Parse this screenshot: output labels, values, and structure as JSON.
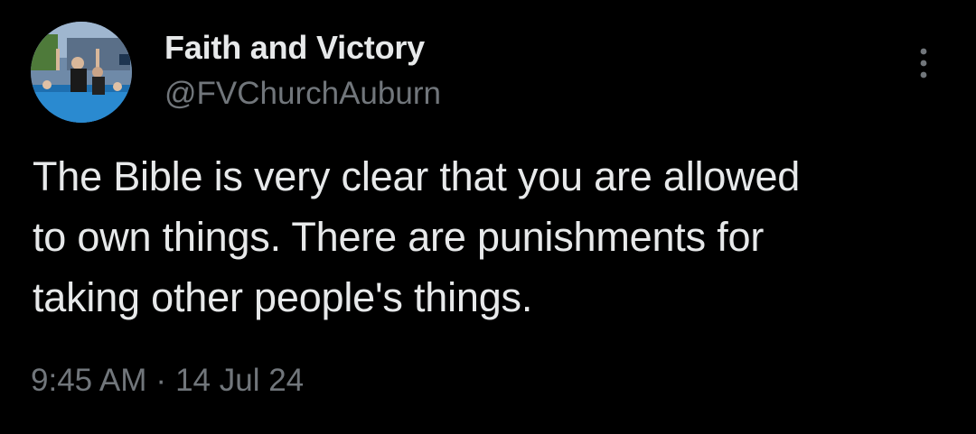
{
  "tweet": {
    "display_name": "Faith and Victory",
    "handle": "@FVChurchAuburn",
    "text": "The Bible is very clear that you are allowed\nto own things.  There are punishments for\ntaking other people's things.",
    "time": "9:45 AM",
    "separator": "·",
    "date": "14 Jul 24",
    "avatar_icon": "avatar-photo-icon",
    "more_icon": "more-options-icon"
  },
  "colors": {
    "background": "#000000",
    "primary_text": "#e7e9ea",
    "secondary_text": "#71767b"
  }
}
